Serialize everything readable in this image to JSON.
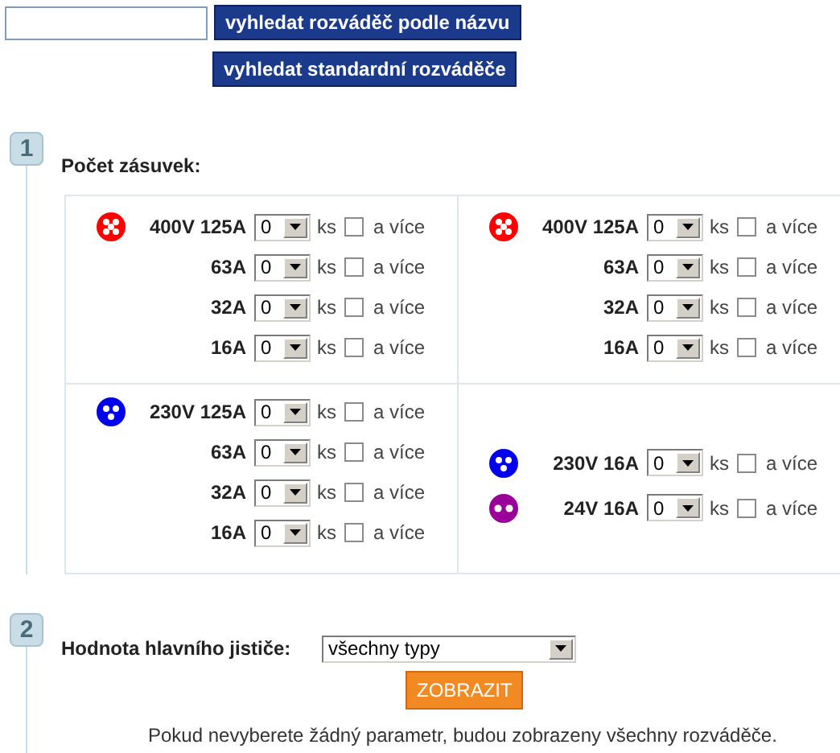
{
  "search": {
    "button": "vyhledat rozváděč podle názvu"
  },
  "standard_button": "vyhledat standardní rozváděče",
  "step_1": {
    "number": "1",
    "title": "Počet zásuvek:",
    "cells": [
      {
        "rows": [
          {
            "kind": "five_pin",
            "color": "#ff0000",
            "label": "400V 125A",
            "count": "0",
            "unit": "ks",
            "more_checked": false,
            "more_label": "a více"
          },
          {
            "kind": "plain",
            "label": "63A",
            "count": "0",
            "unit": "ks",
            "more_checked": false,
            "more_label": "a více"
          },
          {
            "kind": "plain",
            "label": "32A",
            "count": "0",
            "unit": "ks",
            "more_checked": false,
            "more_label": "a více"
          },
          {
            "kind": "plain",
            "label": "16A",
            "count": "0",
            "unit": "ks",
            "more_checked": false,
            "more_label": "a více"
          }
        ]
      },
      {
        "rows": [
          {
            "kind": "five_pin",
            "color": "#ff0000",
            "label": "400V 125A",
            "count": "0",
            "unit": "ks",
            "more_checked": false,
            "more_label": "a více"
          },
          {
            "kind": "plain",
            "label": "63A",
            "count": "0",
            "unit": "ks",
            "more_checked": false,
            "more_label": "a více"
          },
          {
            "kind": "plain",
            "label": "32A",
            "count": "0",
            "unit": "ks",
            "more_checked": false,
            "more_label": "a více"
          },
          {
            "kind": "plain",
            "label": "16A",
            "count": "0",
            "unit": "ks",
            "more_checked": false,
            "more_label": "a více"
          }
        ]
      },
      {
        "rows": [
          {
            "kind": "three_pin",
            "color": "#0000ee",
            "label": "230V 125A",
            "count": "0",
            "unit": "ks",
            "more_checked": false,
            "more_label": "a více"
          },
          {
            "kind": "plain",
            "label": "63A",
            "count": "0",
            "unit": "ks",
            "more_checked": false,
            "more_label": "a více"
          },
          {
            "kind": "plain",
            "label": "32A",
            "count": "0",
            "unit": "ks",
            "more_checked": false,
            "more_label": "a více"
          },
          {
            "kind": "plain",
            "label": "16A",
            "count": "0",
            "unit": "ks",
            "more_checked": false,
            "more_label": "a více"
          }
        ]
      },
      {
        "rows": [
          {
            "kind": "three_pin",
            "color": "#0000ee",
            "label": "230V 16A",
            "count": "0",
            "unit": "ks",
            "more_checked": false,
            "more_label": "a více"
          },
          {
            "kind": "two_pin",
            "color": "#990099",
            "label": "24V 16A",
            "count": "0",
            "unit": "ks",
            "more_checked": false,
            "more_label": "a více"
          }
        ]
      }
    ]
  },
  "step_2": {
    "number": "2",
    "label": "Hodnota hlavního jističe:",
    "select_value": "všechny typy",
    "button": "ZOBRAZIT",
    "note": "Pokud nevyberete žádný parametr, budou zobrazeny všechny rozváděče."
  }
}
